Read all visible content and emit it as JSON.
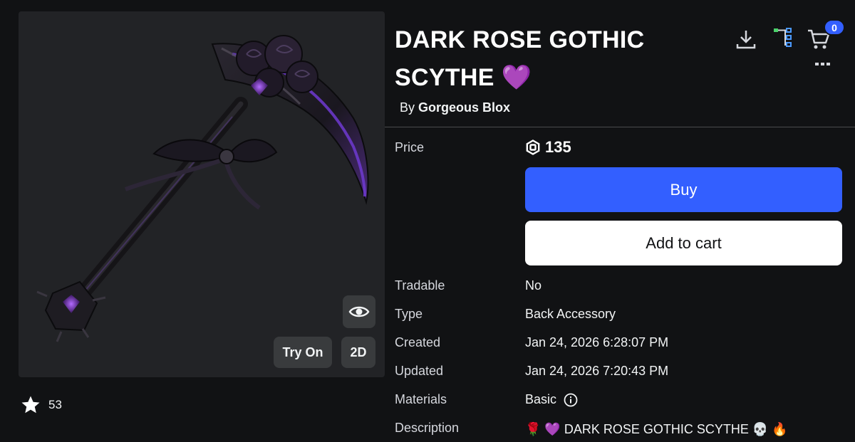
{
  "item": {
    "title": "DARK ROSE GOTHIC SCYTHE 💜",
    "by_prefix": "By",
    "creator": "Gorgeous Blox",
    "favorites": "53"
  },
  "preview": {
    "try_on_label": "Try On",
    "view_2d_label": "2D"
  },
  "header": {
    "cart_count": "0"
  },
  "details": {
    "price_label": "Price",
    "price_value": "135",
    "buy_label": "Buy",
    "add_to_cart_label": "Add to cart",
    "tradable_label": "Tradable",
    "tradable_value": "No",
    "type_label": "Type",
    "type_value": "Back Accessory",
    "created_label": "Created",
    "created_value": "Jan 24, 2026 6:28:07 PM",
    "updated_label": "Updated",
    "updated_value": "Jan 24, 2026 7:20:43 PM",
    "materials_label": "Materials",
    "materials_value": "Basic",
    "description_label": "Description",
    "description_value": "🌹 💜 DARK ROSE GOTHIC SCYTHE 💀 🔥"
  },
  "colors": {
    "accent": "#335fff",
    "background": "#111214",
    "panel": "#222326"
  }
}
